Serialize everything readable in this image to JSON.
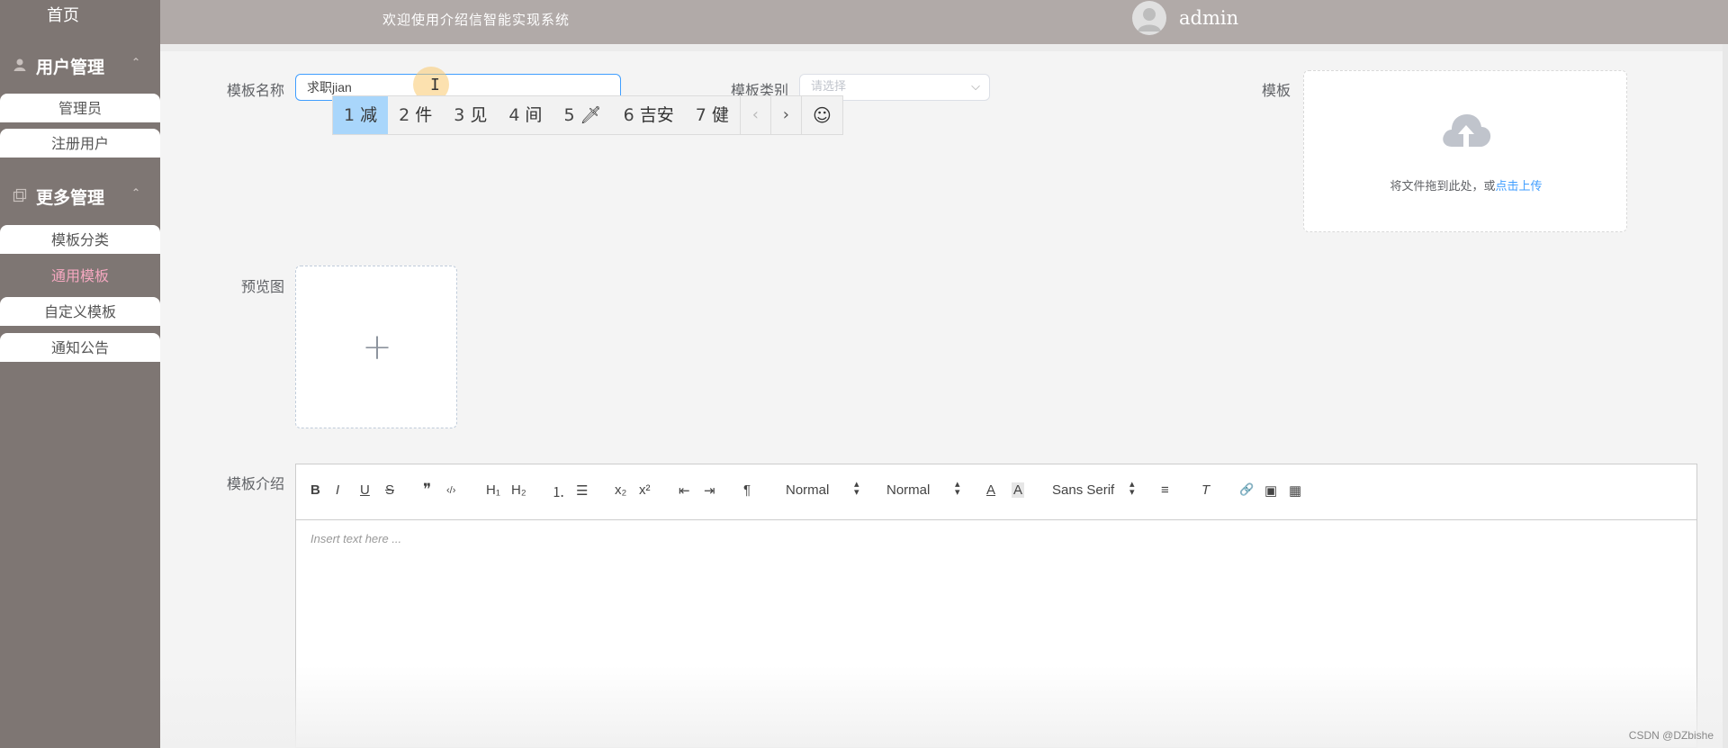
{
  "sidebar": {
    "home": "首页",
    "groups": [
      {
        "label": "用户管理",
        "icon": "user-icon"
      },
      {
        "label": "更多管理",
        "icon": "copy-icon"
      }
    ],
    "items": [
      "管理员",
      "注册用户",
      "模板分类",
      "通用模板",
      "自定义模板",
      "通知公告"
    ],
    "active_item": "通用模板"
  },
  "header": {
    "title": "欢迎使用介绍信智能实现系统",
    "username": "admin"
  },
  "form": {
    "name_label": "模板名称",
    "name_value": "求职jian",
    "category_label": "模板类别",
    "category_placeholder": "请选择",
    "template_label": "模板",
    "upload_text": "将文件拖到此处，或",
    "upload_link": "点击上传",
    "preview_label": "预览图",
    "intro_label": "模板介绍",
    "editor_placeholder": "Insert text here ..."
  },
  "ime": {
    "candidates": [
      {
        "num": "1",
        "text": "减"
      },
      {
        "num": "2",
        "text": "件"
      },
      {
        "num": "3",
        "text": "见"
      },
      {
        "num": "4",
        "text": "间"
      },
      {
        "num": "5",
        "text": "🗡"
      },
      {
        "num": "6",
        "text": "吉安"
      },
      {
        "num": "7",
        "text": "健"
      }
    ],
    "prev": "‹",
    "next": "›",
    "emoji": "☺"
  },
  "toolbar": {
    "bold": "B",
    "italic": "I",
    "underline": "U",
    "strike": "S",
    "blockquote": "❞",
    "code": "‹/›",
    "h1": "H₁",
    "h2": "H₂",
    "ordered": "⒈",
    "bullet": "☰",
    "sub": "x₂",
    "sup": "x²",
    "outdent": "⇤",
    "indent": "⇥",
    "direction": "¶",
    "size": "Normal",
    "header": "Normal",
    "color": "A",
    "background": "A",
    "font": "Sans Serif",
    "align": "≡",
    "clean": "T",
    "link": "🔗",
    "image": "▣",
    "video": "▦"
  },
  "watermark": "CSDN @DZbishe",
  "colors": {
    "sidebar_bg": "#7e7673",
    "header_bg": "#b1aaa8",
    "active_item": "#f5a8c0",
    "link": "#409eff",
    "ime_selected": "#a9d6fb"
  }
}
